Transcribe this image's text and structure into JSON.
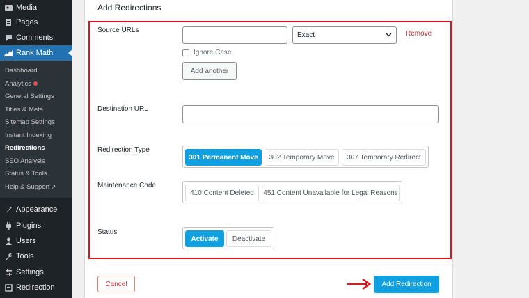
{
  "sidebar": {
    "top_items": [
      {
        "label": "Media",
        "icon": "media-icon"
      },
      {
        "label": "Pages",
        "icon": "pages-icon"
      },
      {
        "label": "Comments",
        "icon": "comments-icon"
      },
      {
        "label": "Rank Math",
        "icon": "rank-math-icon"
      }
    ],
    "submenu": [
      {
        "label": "Dashboard"
      },
      {
        "label": "Analytics"
      },
      {
        "label": "General Settings"
      },
      {
        "label": "Titles & Meta"
      },
      {
        "label": "Sitemap Settings"
      },
      {
        "label": "Instant Indexing"
      },
      {
        "label": "Redirections"
      },
      {
        "label": "SEO Analysis"
      },
      {
        "label": "Status & Tools"
      },
      {
        "label": "Help & Support"
      }
    ],
    "bottom_items": [
      {
        "label": "Appearance",
        "icon": "appearance-icon"
      },
      {
        "label": "Plugins",
        "icon": "plugins-icon"
      },
      {
        "label": "Users",
        "icon": "users-icon"
      },
      {
        "label": "Tools",
        "icon": "tools-icon"
      },
      {
        "label": "Settings",
        "icon": "settings-icon"
      },
      {
        "label": "Redirection",
        "icon": "redirection-icon"
      }
    ],
    "colors": {
      "background": "#1d2327",
      "active": "#2271b1",
      "submenu": "#2c3338"
    }
  },
  "form": {
    "title": "Add Redirections",
    "source_label": "Source URLs",
    "source_value": "",
    "match_type": "Exact",
    "remove_label": "Remove",
    "ignore_case_label": "Ignore Case",
    "add_another_label": "Add another",
    "destination_label": "Destination URL",
    "destination_value": "",
    "redirection_type_label": "Redirection Type",
    "redirection_types": [
      "301 Permanent Move",
      "302 Temporary Move",
      "307 Temporary Redirect"
    ],
    "maintenance_label": "Maintenance Code",
    "maintenance_codes": [
      "410 Content Deleted",
      "451 Content Unavailable for Legal Reasons"
    ],
    "status_label": "Status",
    "status_options": [
      "Activate",
      "Deactivate"
    ],
    "cancel_label": "Cancel",
    "submit_label": "Add Redirection",
    "colors": {
      "primary": "#10a0e0",
      "highlight": "#e0141e",
      "danger": "#d63638"
    }
  }
}
